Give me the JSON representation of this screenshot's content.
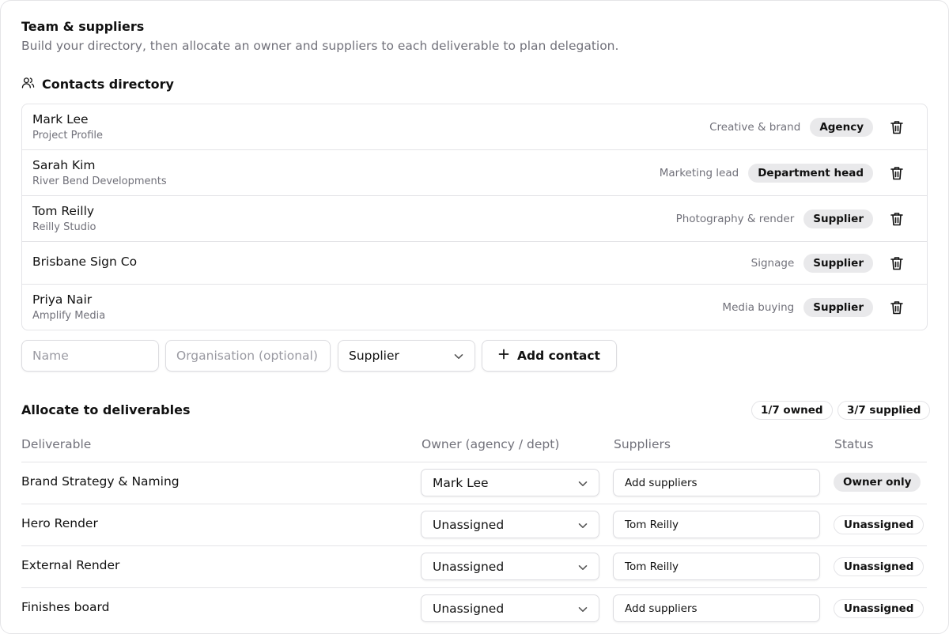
{
  "header": {
    "title": "Team & suppliers",
    "subtitle": "Build your directory, then allocate an owner and suppliers to each deliverable to plan delegation."
  },
  "directory": {
    "title": "Contacts directory",
    "contacts": [
      {
        "name": "Mark Lee",
        "organisation": "Project Profile",
        "role": "Creative & brand",
        "type": "Agency"
      },
      {
        "name": "Sarah Kim",
        "organisation": "River Bend Developments",
        "role": "Marketing lead",
        "type": "Department head"
      },
      {
        "name": "Tom Reilly",
        "organisation": "Reilly Studio",
        "role": "Photography & render",
        "type": "Supplier"
      },
      {
        "name": "Brisbane Sign Co",
        "organisation": "",
        "role": "Signage",
        "type": "Supplier"
      },
      {
        "name": "Priya Nair",
        "organisation": "Amplify Media",
        "role": "Media buying",
        "type": "Supplier"
      }
    ]
  },
  "add_form": {
    "name_placeholder": "Name",
    "org_placeholder": "Organisation (optional)",
    "type_value": "Supplier",
    "add_label": "Add contact"
  },
  "allocation": {
    "title": "Allocate to deliverables",
    "owned_count": "1/7 owned",
    "supplied_count": "3/7 supplied",
    "headers": {
      "deliverable": "Deliverable",
      "owner": "Owner (agency / dept)",
      "suppliers": "Suppliers",
      "status": "Status"
    },
    "rows": [
      {
        "deliverable": "Brand Strategy & Naming",
        "owner": "Mark Lee",
        "suppliers": "Add suppliers",
        "status": "Owner only"
      },
      {
        "deliverable": "Hero Render",
        "owner": "Unassigned",
        "suppliers": "Tom Reilly",
        "status": "Unassigned"
      },
      {
        "deliverable": "External Render",
        "owner": "Unassigned",
        "suppliers": "Tom Reilly",
        "status": "Unassigned"
      },
      {
        "deliverable": "Finishes board",
        "owner": "Unassigned",
        "suppliers": "Add suppliers",
        "status": "Unassigned"
      }
    ]
  },
  "colors": {
    "border": "#e4e4e7",
    "muted_text": "#71717a",
    "pill_bg": "#e9e9eb",
    "text": "#111111"
  },
  "icons": {
    "section": "users-icon",
    "delete": "trash-icon",
    "add": "plus-icon",
    "dropdown": "chevron-down-icon"
  }
}
